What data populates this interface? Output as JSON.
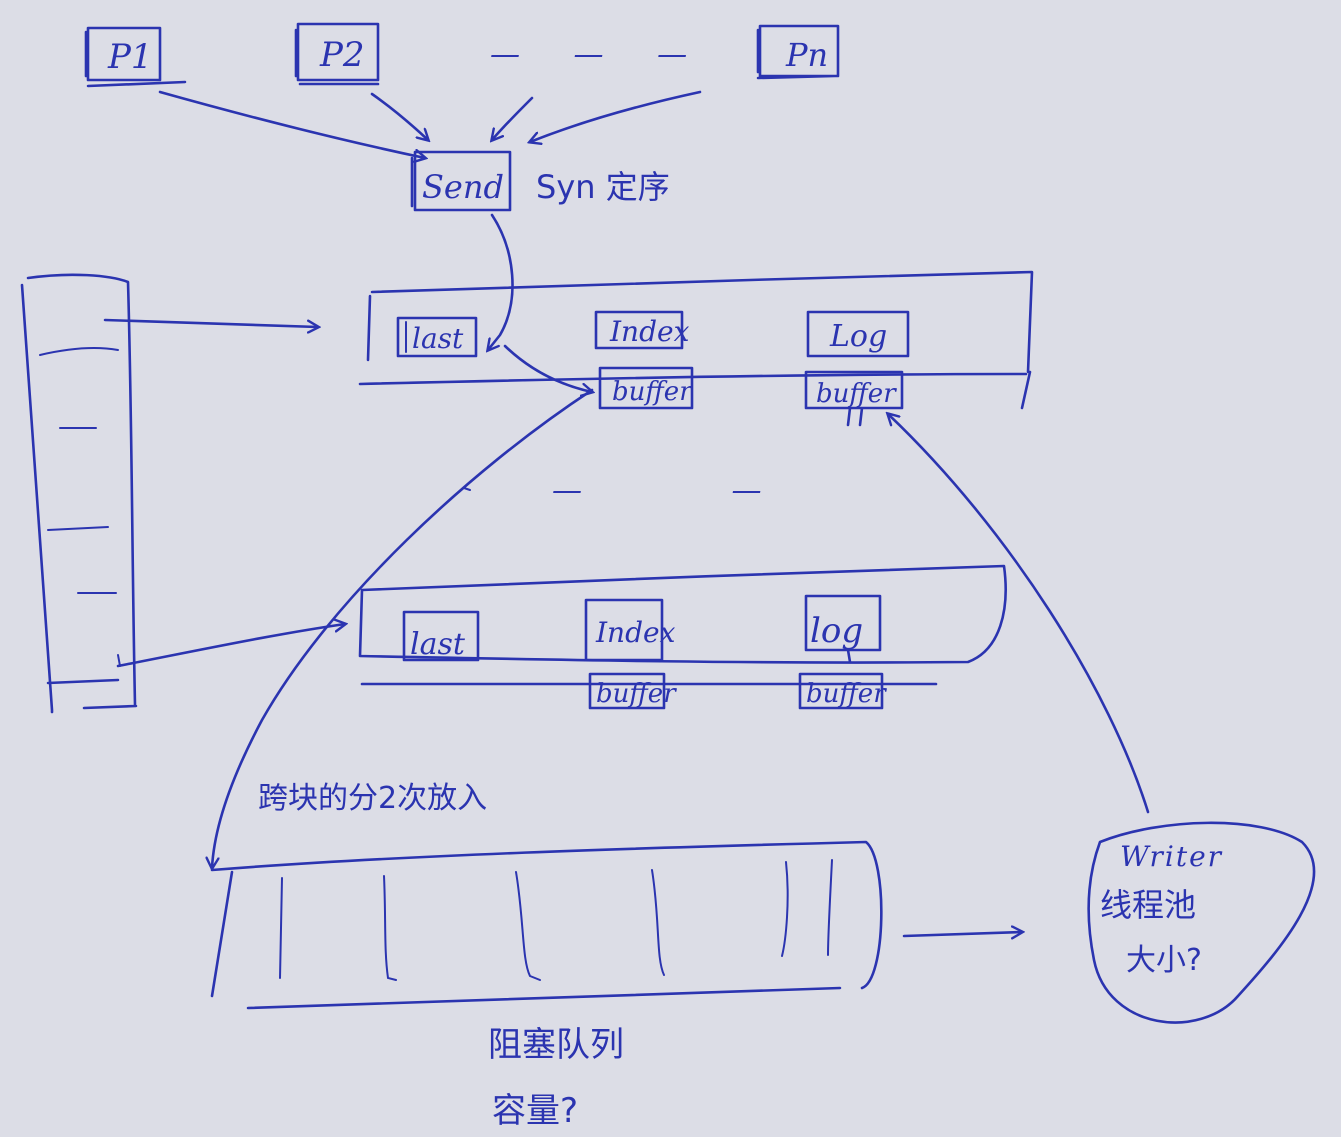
{
  "ink_color": "#2b34b0",
  "paper_color": "#dcdde6",
  "producers": [
    "P1",
    "P2",
    "Pn"
  ],
  "producer_ellipsis": "— — —",
  "send": {
    "label": "Send",
    "note": "Syn 定序"
  },
  "segment_top": {
    "last": "last",
    "index": "Index",
    "log": "Log",
    "index_buffer": "buffer",
    "log_buffer": "buffer"
  },
  "segment_ellipsis": "— —",
  "segment_bottom": {
    "last": "last",
    "index": "Index",
    "log": "log",
    "index_buffer": "buffer",
    "log_buffer": "buffer"
  },
  "cross_note": "跨块的分2次放入",
  "queue": {
    "label": "阻塞队列",
    "capacity_note": "容量?"
  },
  "writer": {
    "label": "Writer",
    "pool_note": "线程池",
    "size_note": "大小?"
  }
}
